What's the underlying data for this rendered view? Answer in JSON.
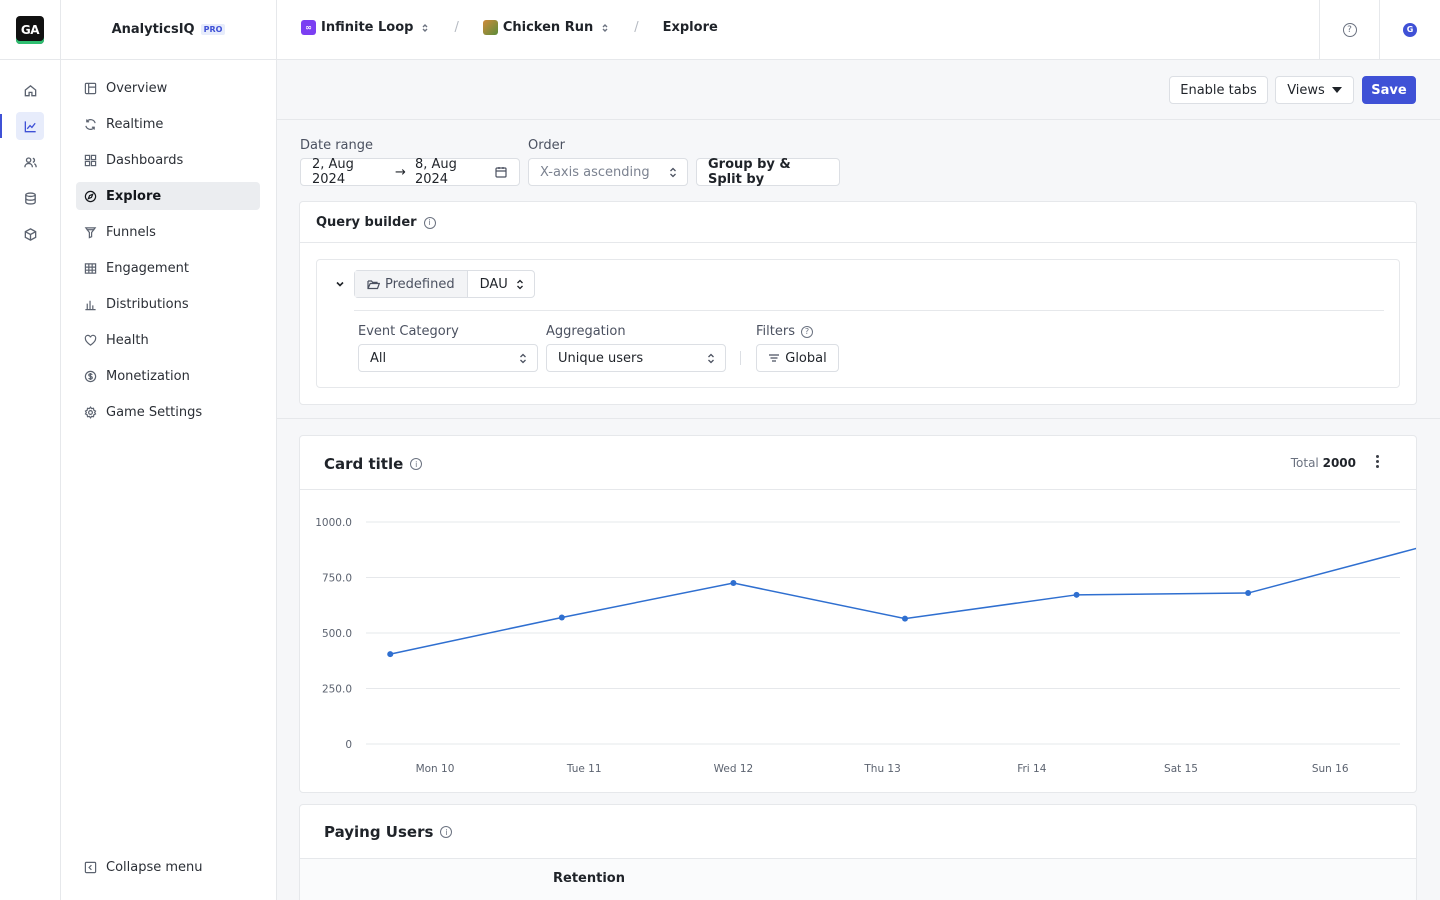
{
  "app": {
    "logo": "GA",
    "name": "AnalyticsIQ",
    "tier": "PRO"
  },
  "rail": {
    "items": [
      {
        "icon": "home-icon"
      },
      {
        "icon": "chart-line-icon",
        "active": true
      },
      {
        "icon": "users-icon"
      },
      {
        "icon": "database-icon"
      },
      {
        "icon": "cube-icon"
      }
    ]
  },
  "sidebar": {
    "items": [
      {
        "label": "Overview",
        "icon": "overview-icon"
      },
      {
        "label": "Realtime",
        "icon": "refresh-icon"
      },
      {
        "label": "Dashboards",
        "icon": "grid-icon"
      },
      {
        "label": "Explore",
        "icon": "compass-icon",
        "active": true
      },
      {
        "label": "Funnels",
        "icon": "funnel-icon"
      },
      {
        "label": "Engagement",
        "icon": "table-icon"
      },
      {
        "label": "Distributions",
        "icon": "bar-chart-icon"
      },
      {
        "label": "Health",
        "icon": "heart-icon"
      },
      {
        "label": "Monetization",
        "icon": "dollar-icon"
      },
      {
        "label": "Game Settings",
        "icon": "gear-icon"
      }
    ],
    "collapse_label": "Collapse menu"
  },
  "breadcrumb": {
    "org": "Infinite Loop",
    "game": "Chicken Run",
    "page": "Explore",
    "separator": "/"
  },
  "topbar": {
    "help_icon": "help-icon",
    "avatar_letter": "G"
  },
  "actions": {
    "enable_tabs": "Enable tabs",
    "views": "Views",
    "save": "Save"
  },
  "filters": {
    "date_range_label": "Date range",
    "date_start": "2, Aug 2024",
    "date_arrow": "→",
    "date_end": "8, Aug 2024",
    "order_label": "Order",
    "order_value": "X-axis ascending",
    "group_split": "Group by & Split by"
  },
  "query_builder": {
    "title": "Query builder",
    "predefined": "Predefined",
    "metric": "DAU",
    "event_category_label": "Event Category",
    "event_category_value": "All",
    "aggregation_label": "Aggregation",
    "aggregation_value": "Unique users",
    "filters_label": "Filters",
    "filters_value": "Global"
  },
  "card": {
    "title": "Card title",
    "total_label": "Total",
    "total_value": "2000"
  },
  "chart_data": {
    "type": "line",
    "categories": [
      "Mon 10",
      "Tue 11",
      "Wed 12",
      "Thu 13",
      "Fri 14",
      "Sat 15",
      "Sun 16"
    ],
    "x_positions": [
      0,
      1,
      2,
      3,
      4,
      5,
      6
    ],
    "series": [
      {
        "values": [
          405,
          570,
          725,
          565,
          672,
          680,
          885
        ]
      }
    ],
    "point_x": [
      -0.3,
      0.85,
      2.0,
      3.15,
      4.3,
      5.45,
      6.6
    ],
    "yticks": [
      "1000.0",
      "750.0",
      "500.0",
      "250.0",
      "0"
    ],
    "ylim": [
      0,
      1000
    ],
    "grid": true,
    "line_color": "#2f6fd0"
  },
  "paying_users": {
    "title": "Paying Users",
    "column": "Retention"
  }
}
